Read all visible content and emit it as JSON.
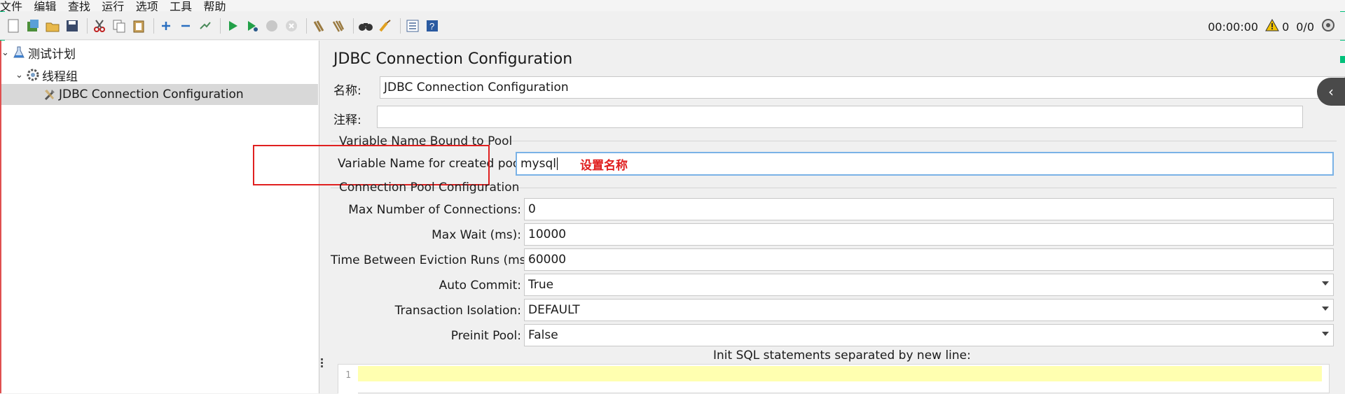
{
  "menu": [
    "文件",
    "编辑",
    "查找",
    "运行",
    "选项",
    "工具",
    "帮助"
  ],
  "toolbar_status": {
    "timer": "00:00:00",
    "warning_count": "0",
    "thread_ratio": "0/0"
  },
  "tree": {
    "items": [
      {
        "label": "测试计划",
        "icon": "flask-icon"
      },
      {
        "label": "线程组",
        "icon": "gear-icon"
      },
      {
        "label": "JDBC Connection Configuration",
        "icon": "wrench-icon"
      }
    ]
  },
  "panel": {
    "title": "JDBC Connection Configuration",
    "name_label": "名称:",
    "name_value": "JDBC Connection Configuration",
    "comment_label": "注释:",
    "comment_value": "",
    "section_bound": "Variable Name Bound to Pool",
    "var_label": "Variable Name for created pool:",
    "var_value": "mysql",
    "annotation": "设置名称",
    "section_pool": "Connection Pool Configuration",
    "fields": [
      {
        "label": "Max Number of Connections:",
        "value": "0"
      },
      {
        "label": "Max Wait (ms):",
        "value": "10000"
      },
      {
        "label": "Time Between Eviction Runs (ms):",
        "value": "60000"
      },
      {
        "label": "Auto Commit:",
        "value": "True"
      },
      {
        "label": "Transaction Isolation:",
        "value": "DEFAULT"
      },
      {
        "label": "Preinit Pool:",
        "value": "False"
      }
    ],
    "init_sql_label": "Init SQL statements separated by new line:",
    "editor_line_number": "1"
  },
  "colors": {
    "accent_green": "#00c07a",
    "annotation_red": "#e02020",
    "focus_blue": "#7ab2e6",
    "editor_highlight": "#ffffb0"
  }
}
